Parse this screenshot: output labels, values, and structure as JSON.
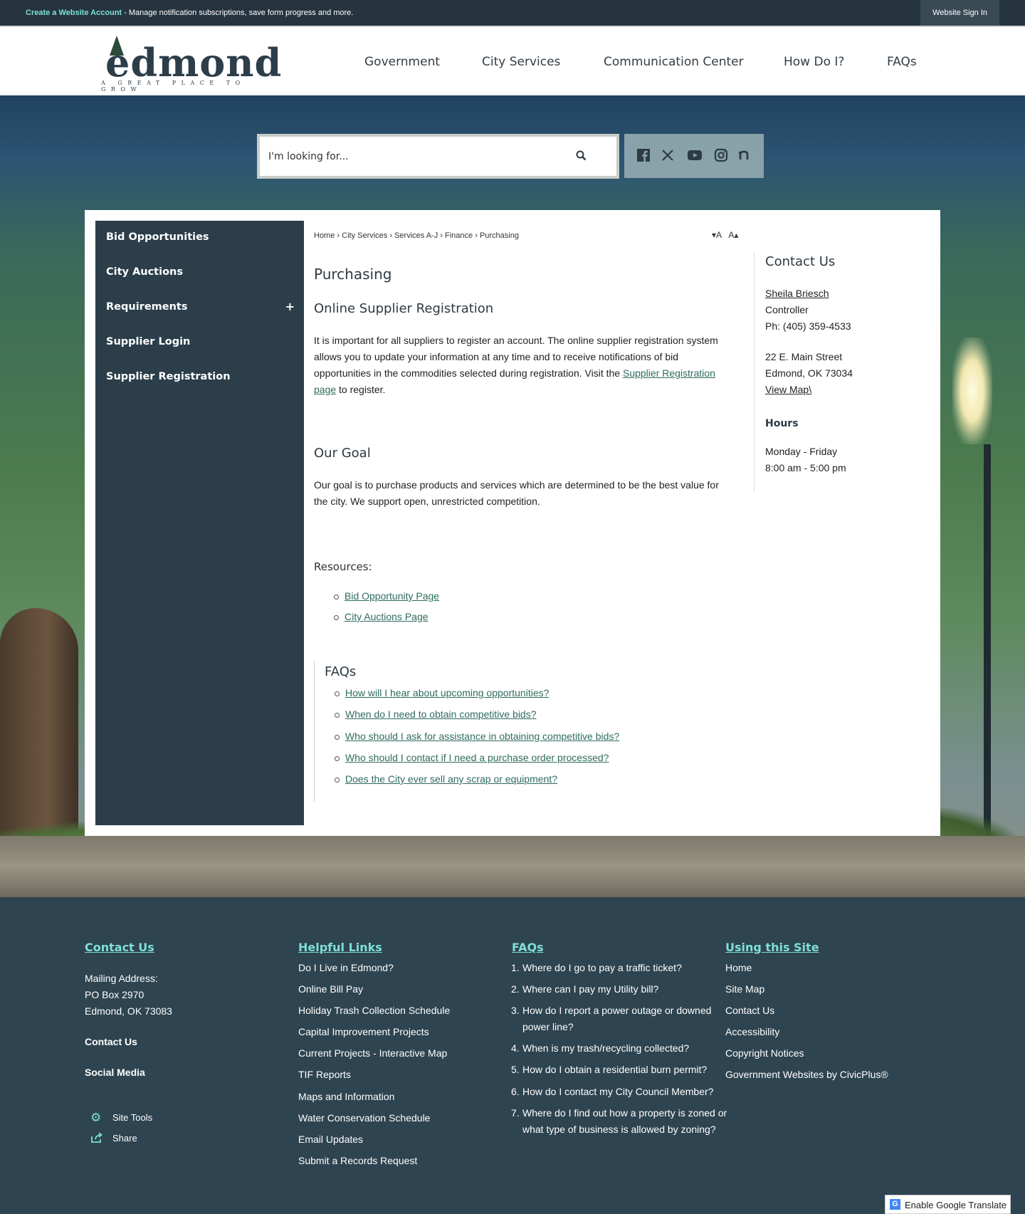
{
  "topbar": {
    "create_account": "Create a Website Account",
    "message": " - Manage notification subscriptions, save form progress and more.",
    "sign_in": "Website Sign In"
  },
  "logo": {
    "word": "edmond",
    "tagline": "A GREAT PLACE TO GROW"
  },
  "nav": [
    "Government",
    "City Services",
    "Communication Center",
    "How Do I?",
    "FAQs"
  ],
  "search": {
    "placeholder": "I'm looking for..."
  },
  "social": [
    "facebook-icon",
    "x-icon",
    "youtube-icon",
    "instagram-icon",
    "nextdoor-icon"
  ],
  "sidenav": [
    {
      "label": "Bid Opportunities"
    },
    {
      "label": "City Auctions"
    },
    {
      "label": "Requirements",
      "expand": "+"
    },
    {
      "label": "Supplier Login"
    },
    {
      "label": "Supplier Registration"
    }
  ],
  "breadcrumb": [
    "Home",
    "City Services",
    "Services A-J",
    "Finance",
    "Purchasing"
  ],
  "fontctl": {
    "smaller": "▾A",
    "larger": "A▴"
  },
  "main": {
    "title": "Purchasing",
    "section1_title": "Online Supplier Registration",
    "section1_text_a": "It is important for all suppliers to register an account. The online supplier registration system allows you to update your information at any time and to receive notifications of bid opportunities in the commodities selected during registration. Visit the ",
    "section1_link": "Supplier Registration page",
    "section1_text_b": " to register.",
    "section2_title": "Our Goal",
    "section2_text": "Our goal is to purchase products and services which are determined to be the best value for the city. We support open, unrestricted competition.",
    "resources_title": "Resources:",
    "resources": [
      "Bid Opportunity Page",
      "City Auctions Page"
    ],
    "faqs_title": "FAQs",
    "faqs": [
      "How will I hear about upcoming opportunities?",
      "When do I need to obtain competitive bids?",
      "Who should I ask for assistance in obtaining competitive bids?",
      "Who should I contact if I need a purchase order processed?",
      "Does the City ever sell any scrap or equipment?"
    ]
  },
  "contact": {
    "title": "Contact Us",
    "name": "Sheila Briesch",
    "role": "Controller",
    "phone": "Ph: (405) 359-4533",
    "address1": "22 E. Main Street",
    "address2": "Edmond, OK 73034",
    "map_link": "View Map\\",
    "hours_title": "Hours",
    "hours_days": "Monday - Friday",
    "hours_time": "8:00 am - 5:00 pm"
  },
  "footer": {
    "contact": {
      "title": "Contact Us",
      "mailing_label": "Mailing Address:",
      "po": "PO Box 2970",
      "city": "Edmond, OK 73083",
      "contact_us": "Contact Us",
      "social_media": "Social Media",
      "site_tools": "Site Tools",
      "share": "Share"
    },
    "helpful": {
      "title": "Helpful Links",
      "links": [
        "Do I Live in Edmond?",
        "Online Bill Pay",
        "Holiday Trash Collection Schedule",
        "Capital Improvement Projects",
        "Current Projects - Interactive Map",
        "TIF Reports",
        "Maps and Information",
        "Water Conservation Schedule",
        "Email Updates",
        "Submit a Records Request"
      ]
    },
    "faqs": {
      "title": "FAQs",
      "items": [
        "Where do I go to pay a traffic ticket?",
        "Where can I pay my Utility bill?",
        "How do I report a power outage or downed power line?",
        "When is my trash/recycling collected?",
        "How do I obtain a residential burn permit?",
        "How do I contact my City Council Member?",
        "Where do I find out how a property is zoned or what type of business is allowed by zoning?"
      ]
    },
    "site": {
      "title": "Using this Site",
      "links": [
        "Home",
        "Site Map",
        "Contact Us",
        "Accessibility",
        "Copyright Notices",
        "Government Websites by CivicPlus®"
      ]
    }
  },
  "translate": {
    "label": "Enable Google Translate",
    "icon": "G"
  }
}
